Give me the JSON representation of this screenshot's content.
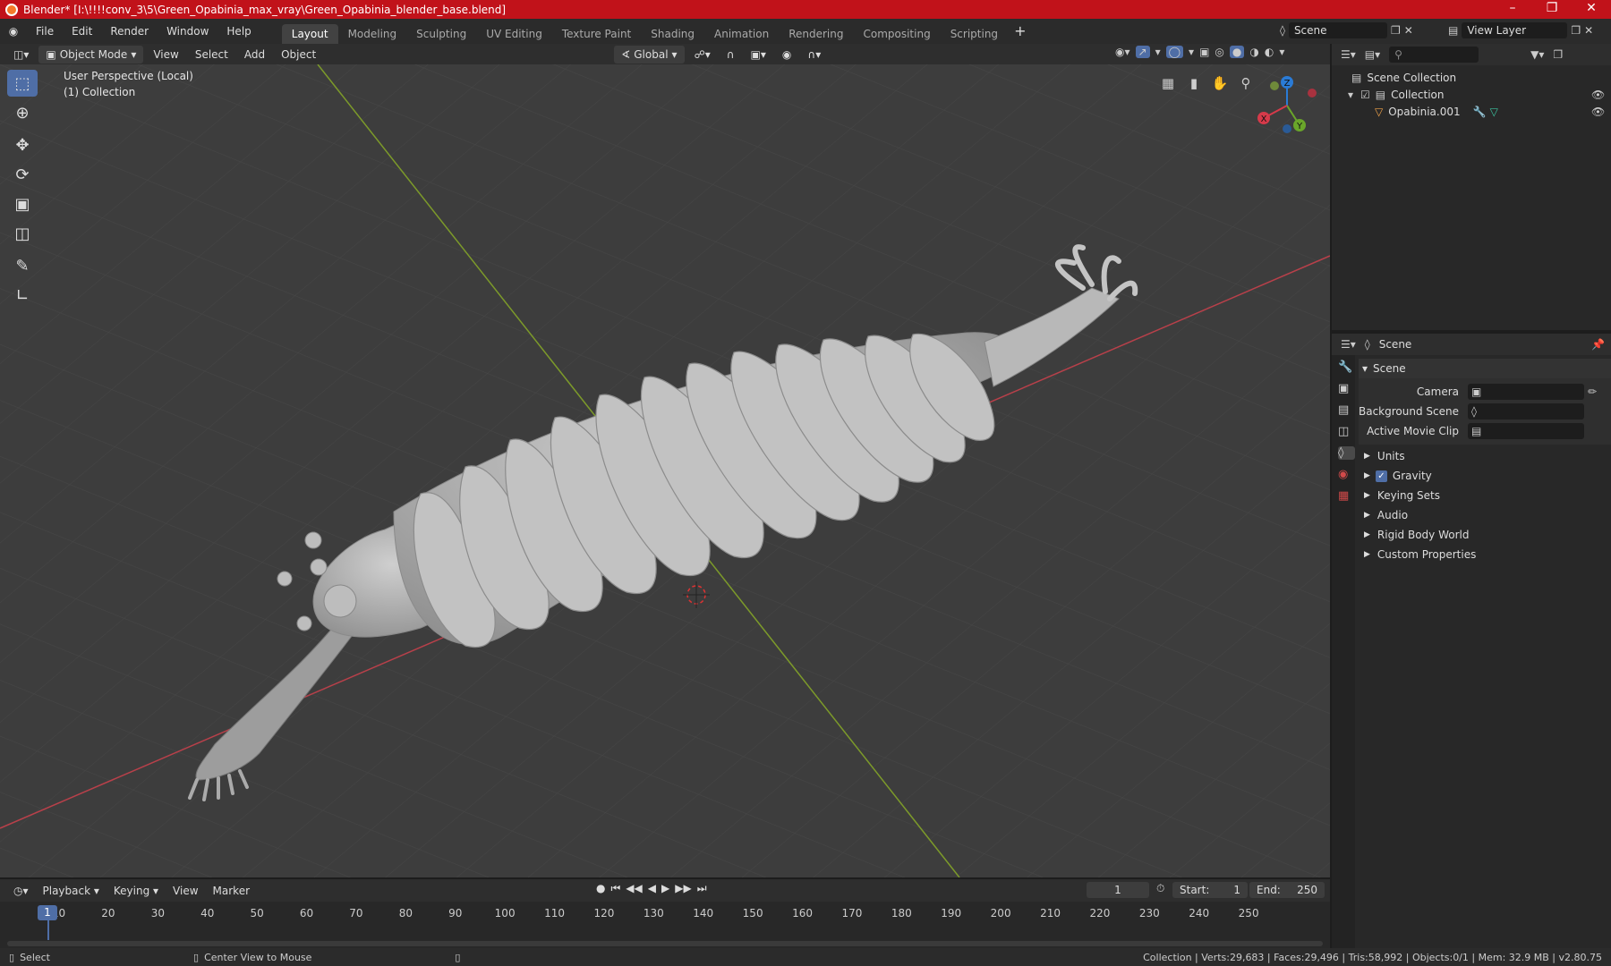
{
  "window": {
    "title": "Blender* [I:\\!!!!conv_3\\5\\Green_Opabinia_max_vray\\Green_Opabinia_blender_base.blend]"
  },
  "menu": [
    "File",
    "Edit",
    "Render",
    "Window",
    "Help"
  ],
  "workspaces": [
    "Layout",
    "Modeling",
    "Sculpting",
    "UV Editing",
    "Texture Paint",
    "Shading",
    "Animation",
    "Rendering",
    "Compositing",
    "Scripting"
  ],
  "active_workspace": "Layout",
  "scene_selector": "Scene",
  "view_layer": "View Layer",
  "viewport_header": {
    "mode": "Object Mode",
    "menus": [
      "View",
      "Select",
      "Add",
      "Object"
    ],
    "orientation": "Global"
  },
  "viewport": {
    "perspective": "User Perspective (Local)",
    "collection": "(1) Collection"
  },
  "gizmo": {
    "x": "X",
    "y": "Y",
    "z": "Z"
  },
  "outliner": {
    "scene_collection": "Scene Collection",
    "collection": "Collection",
    "object": "Opabinia.001"
  },
  "properties": {
    "context": "Scene",
    "panel": "Scene",
    "camera_label": "Camera",
    "background_scene_label": "Background Scene",
    "active_clip_label": "Active Movie Clip",
    "sections": [
      "Units",
      "Gravity",
      "Keying Sets",
      "Audio",
      "Rigid Body World",
      "Custom Properties"
    ],
    "gravity_checked": true
  },
  "timeline": {
    "menus": [
      "Playback",
      "Keying",
      "View",
      "Marker"
    ],
    "current_frame": "1",
    "start_label": "Start:",
    "start": "1",
    "end_label": "End:",
    "end": "250",
    "ticks": [
      "1",
      "10",
      "20",
      "30",
      "40",
      "50",
      "60",
      "70",
      "80",
      "90",
      "100",
      "110",
      "120",
      "130",
      "140",
      "150",
      "160",
      "170",
      "180",
      "190",
      "200",
      "210",
      "220",
      "230",
      "240",
      "250"
    ]
  },
  "status": {
    "select": "Select",
    "center": "Center View to Mouse",
    "stats": "Collection | Verts:29,683 | Faces:29,496 | Tris:58,992 | Objects:0/1 | Mem: 32.9 MB | v2.80.75"
  }
}
